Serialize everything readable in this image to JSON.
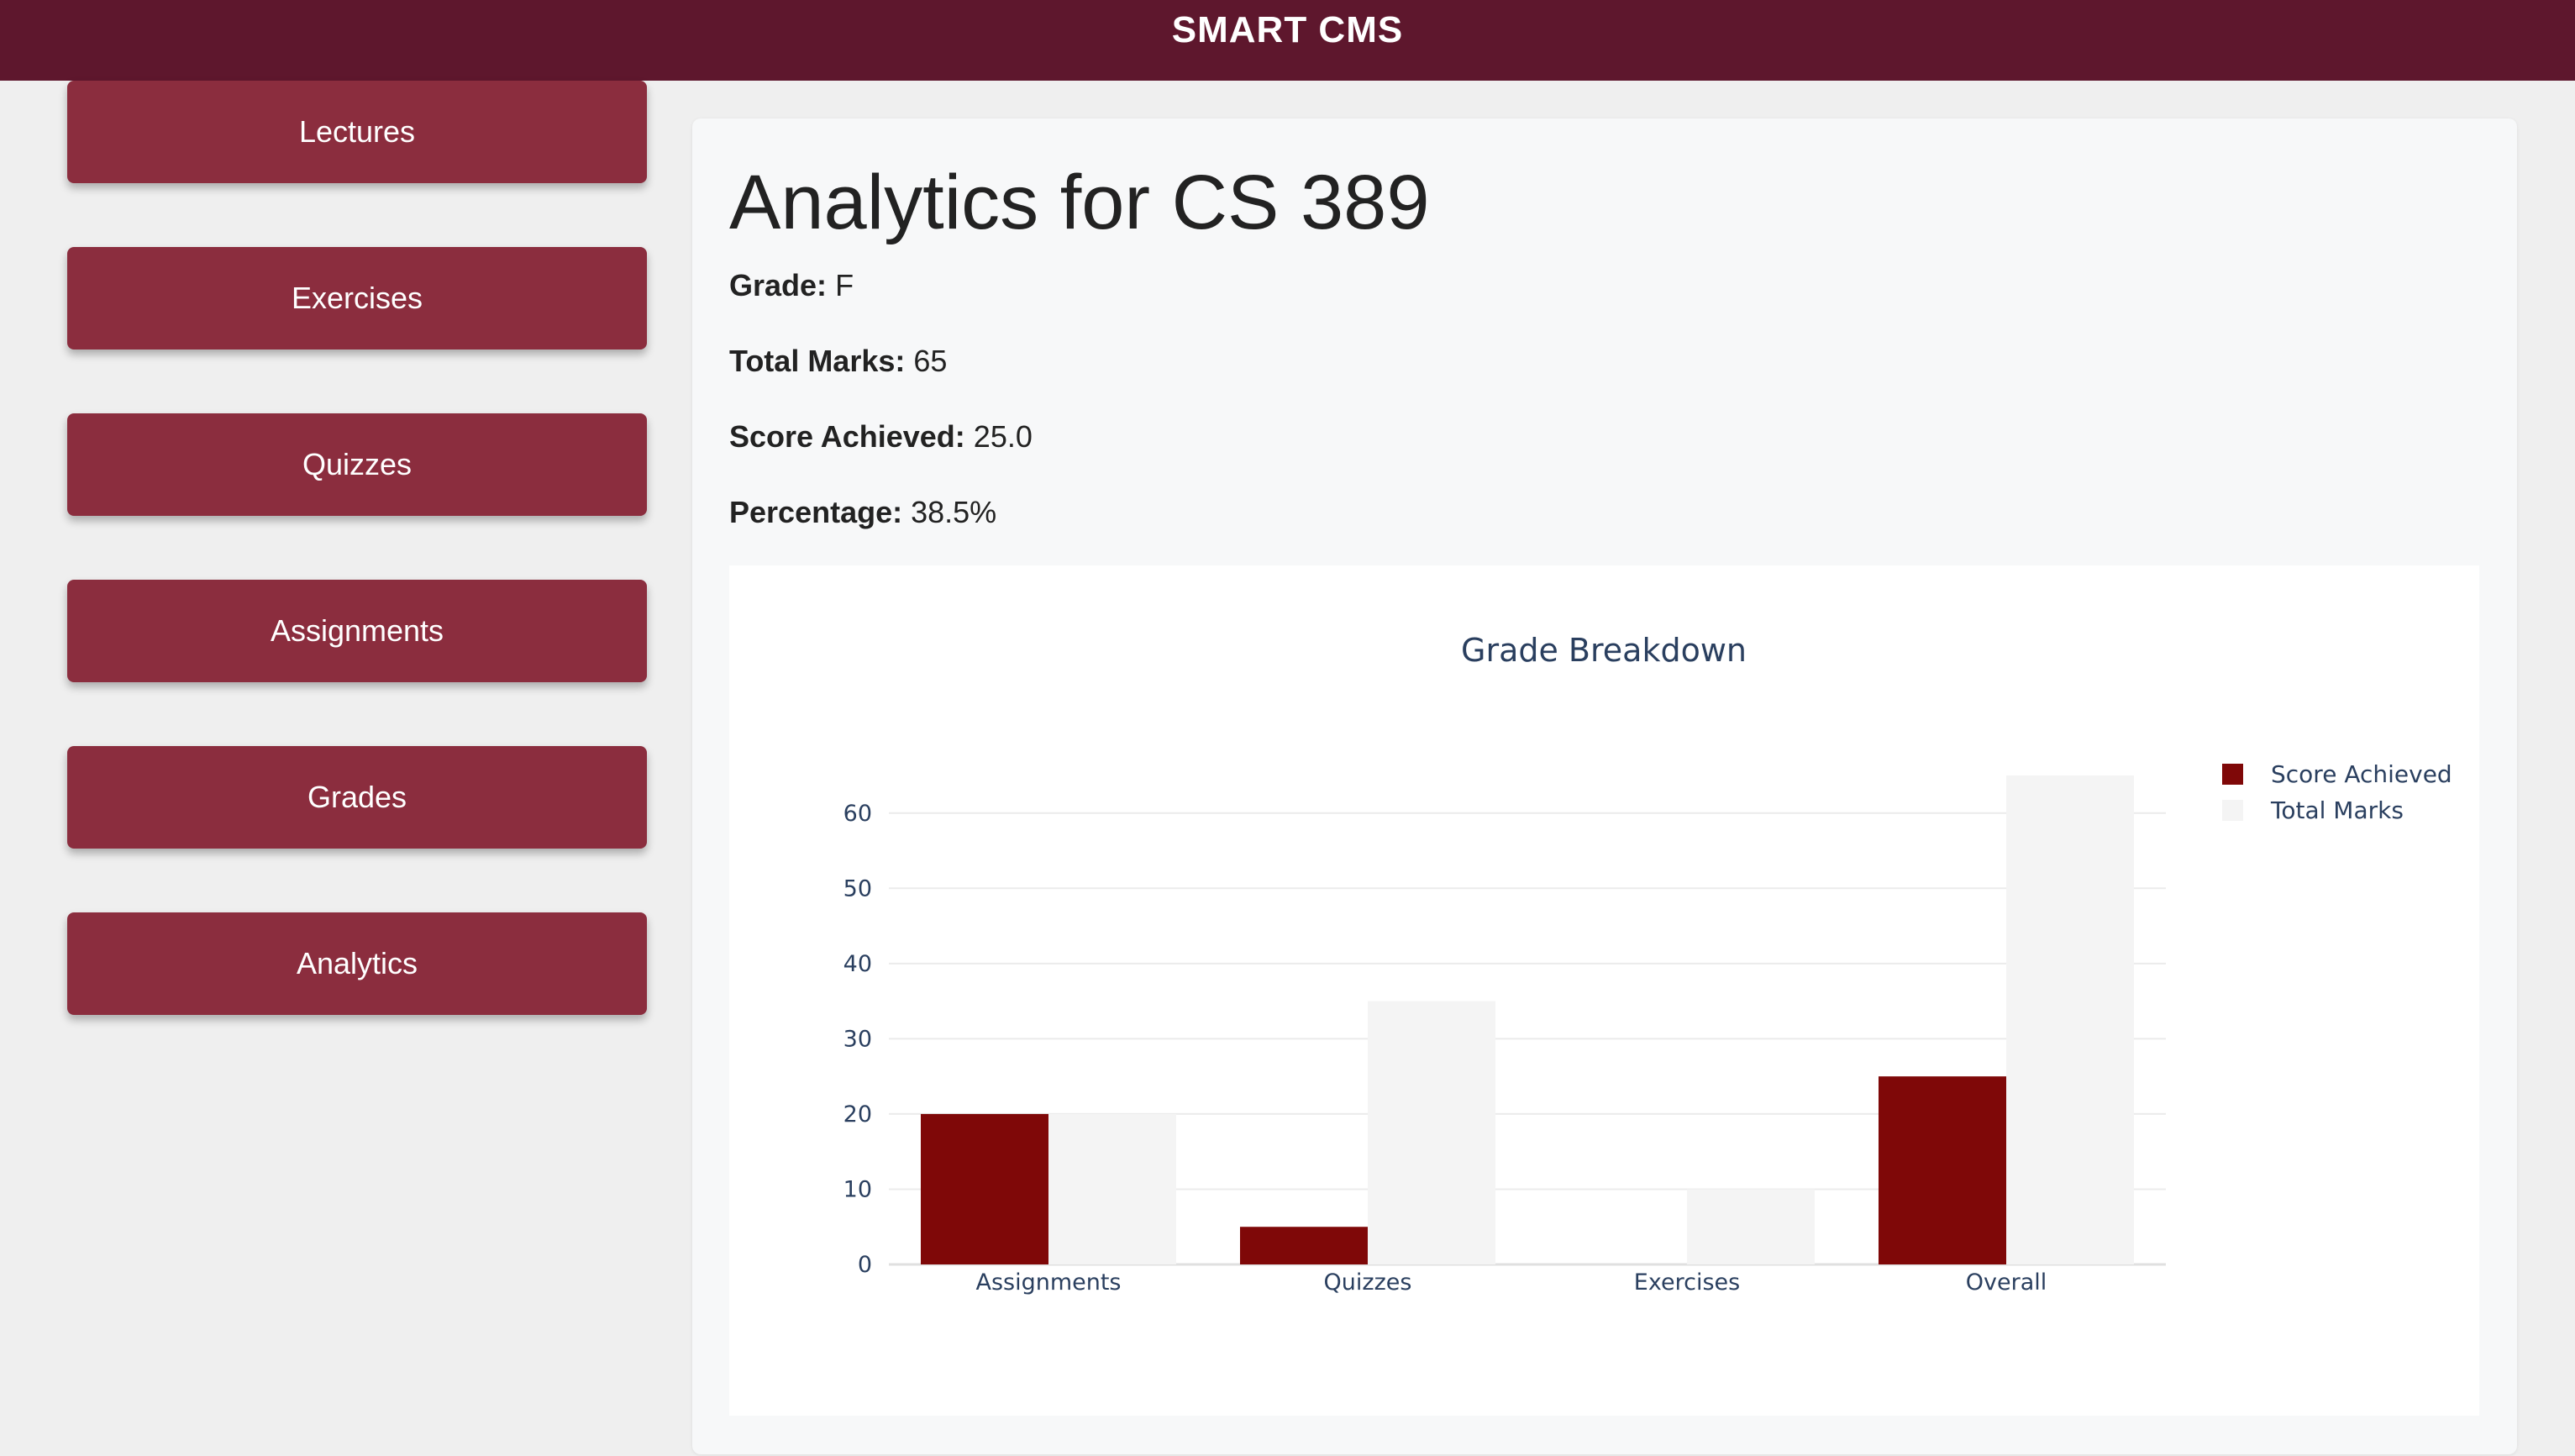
{
  "header": {
    "title": "SMART CMS"
  },
  "sidebar": {
    "items": [
      {
        "label": "Lectures"
      },
      {
        "label": "Exercises"
      },
      {
        "label": "Quizzes"
      },
      {
        "label": "Assignments"
      },
      {
        "label": "Grades"
      },
      {
        "label": "Analytics"
      }
    ]
  },
  "main": {
    "title": "Analytics for CS 389",
    "stats": {
      "grade": {
        "label": "Grade:",
        "value": "F"
      },
      "total_marks": {
        "label": "Total Marks:",
        "value": "65"
      },
      "score": {
        "label": "Score Achieved:",
        "value": "25.0"
      },
      "percentage": {
        "label": "Percentage:",
        "value": "38.5%"
      }
    }
  },
  "colors": {
    "header": "#5e172d",
    "sidebar_button": "#8b2d3e",
    "score_bar": "#7f0808",
    "total_bar": "#f4f4f4"
  },
  "chart_data": {
    "type": "bar",
    "title": "Grade Breakdown",
    "categories": [
      "Assignments",
      "Quizzes",
      "Exercises",
      "Overall"
    ],
    "series": [
      {
        "name": "Score Achieved",
        "color": "#7f0808",
        "values": [
          20,
          5,
          0,
          25
        ]
      },
      {
        "name": "Total Marks",
        "color": "#f4f4f4",
        "values": [
          20,
          35,
          10,
          65
        ]
      }
    ],
    "yticks": [
      0,
      10,
      20,
      30,
      40,
      50,
      60
    ],
    "ylim": [
      0,
      65
    ],
    "grid": true,
    "legend": "top-right",
    "xlabel": "",
    "ylabel": ""
  }
}
